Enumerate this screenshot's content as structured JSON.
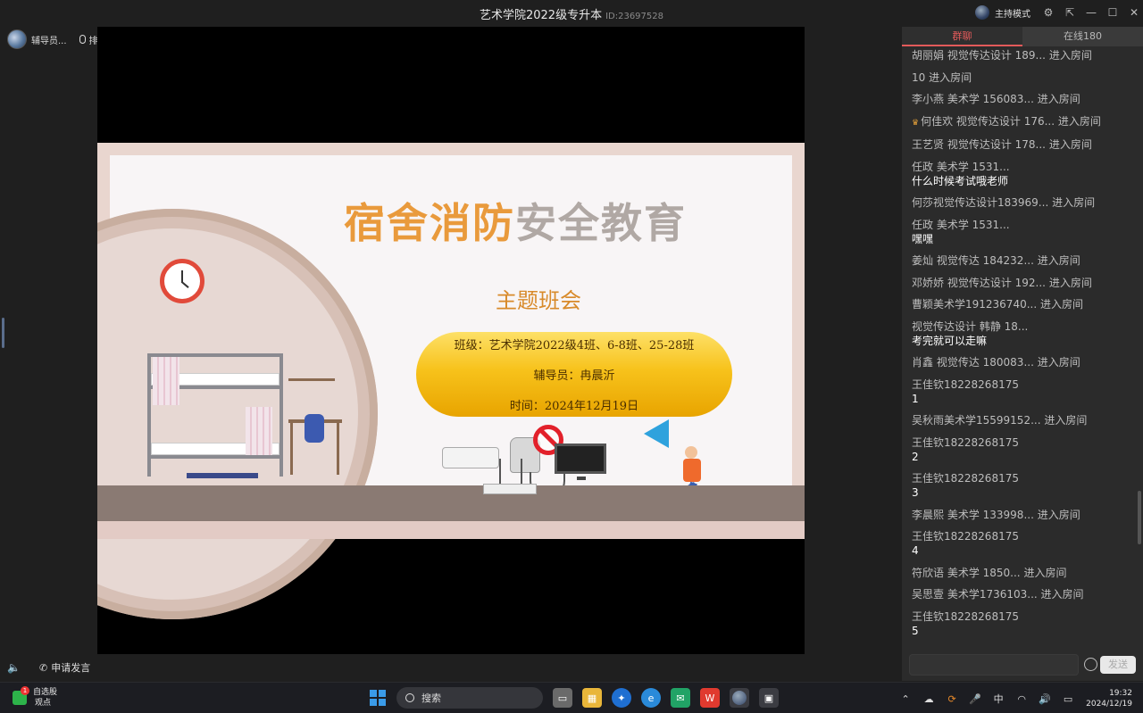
{
  "window": {
    "title": "艺术学院2022级专升本",
    "room_id": "ID:23697528",
    "host_mode": "主持模式"
  },
  "top_left": {
    "tutor_name": "辅导员...",
    "mic_label": "排麦"
  },
  "slide": {
    "title_part1": "宿舍消防",
    "title_part2": "安全教育",
    "subtitle": "主题班会",
    "class_line": "班级：艺术学院2022级4班、6-8班、25-28班",
    "tutor_line": "辅导员：冉晨沂",
    "time_line": "时间：2024年12月19日"
  },
  "video_bottom": {
    "apply_speak": "申请发言"
  },
  "chat": {
    "tabs": [
      {
        "label": "群聊",
        "active": true
      },
      {
        "label": "在线180",
        "active": false
      }
    ],
    "messages": [
      {
        "user": "胡丽娟 视觉传达设计 189...",
        "text": "进入房间",
        "type": "join"
      },
      {
        "user": "10",
        "text": "进入房间",
        "type": "join"
      },
      {
        "user": "李小燕 美术学 156083...",
        "text": "进入房间",
        "type": "join"
      },
      {
        "user": "何佳欢 视觉传达设计 176...",
        "text": "进入房间",
        "type": "join",
        "crown": true
      },
      {
        "user": "王艺贤 视觉传达设计 178...",
        "text": "进入房间",
        "type": "join"
      },
      {
        "user": "任政   美术学   1531...",
        "text": "什么时候考试哦老师",
        "type": "chat"
      },
      {
        "user": "何莎视觉传达设计183969...",
        "text": "进入房间",
        "type": "join"
      },
      {
        "user": "任政   美术学   1531...",
        "text": "嘿嘿",
        "type": "chat"
      },
      {
        "user": "姜灿 视觉传达 184232...",
        "text": "进入房间",
        "type": "join"
      },
      {
        "user": "邓娇娇 视觉传达设计 192...",
        "text": "进入房间",
        "type": "join"
      },
      {
        "user": "曹颖美术学191236740...",
        "text": "进入房间",
        "type": "join"
      },
      {
        "user": "视觉传达设计   韩静   18...",
        "text": "考完就可以走嘛",
        "type": "chat"
      },
      {
        "user": "肖鑫 视觉传达 180083...",
        "text": "进入房间",
        "type": "join"
      },
      {
        "user": "王佳钦18228268175",
        "text": "1",
        "type": "chat"
      },
      {
        "user": "吴秋雨美术学15599152...",
        "text": "进入房间",
        "type": "join"
      },
      {
        "user": "王佳钦18228268175",
        "text": "2",
        "type": "chat"
      },
      {
        "user": "王佳钦18228268175",
        "text": "3",
        "type": "chat"
      },
      {
        "user": "李晨熙 美术学 133998...",
        "text": "进入房间",
        "type": "join"
      },
      {
        "user": "王佳钦18228268175",
        "text": "4",
        "type": "chat"
      },
      {
        "user": "符欣语   美术学   1850...",
        "text": "进入房间",
        "type": "join"
      },
      {
        "user": "吴思壹 美术学1736103...",
        "text": "进入房间",
        "type": "join"
      },
      {
        "user": "王佳钦18228268175",
        "text": "5",
        "type": "chat"
      }
    ],
    "send_label": "发送"
  },
  "taskbar": {
    "stock_label": "自选股",
    "stock_sub": "观点",
    "stock_badge": "1",
    "search_label": "搜索",
    "ime": "中",
    "time": "19:32",
    "date": "2024/12/19"
  }
}
